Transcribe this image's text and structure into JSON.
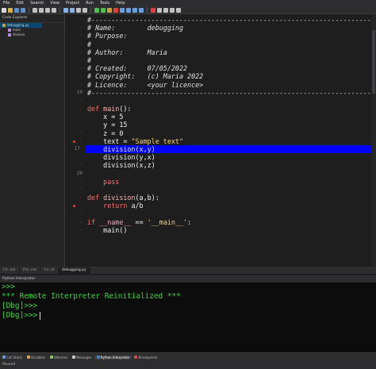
{
  "menu": [
    "File",
    "Edit",
    "Search",
    "View",
    "Project",
    "Run",
    "Tools",
    "Help"
  ],
  "explorer": {
    "title": "Code Explorer",
    "items": [
      {
        "label": "debugging.py"
      },
      {
        "label": "main"
      },
      {
        "label": "division"
      }
    ]
  },
  "editor": {
    "lines": [
      {
        "num": "",
        "bp": false,
        "current": false,
        "tokens": [
          {
            "c": "cm",
            "t": "#----------------------------------------------------------------------------------"
          }
        ]
      },
      {
        "num": "",
        "bp": false,
        "current": false,
        "tokens": [
          {
            "c": "cm",
            "t": "# Name:        debugging"
          }
        ]
      },
      {
        "num": "",
        "bp": false,
        "current": false,
        "tokens": [
          {
            "c": "cm",
            "t": "# Purpose:"
          }
        ]
      },
      {
        "num": "",
        "bp": false,
        "current": false,
        "tokens": [
          {
            "c": "cm",
            "t": "#"
          }
        ]
      },
      {
        "num": "",
        "bp": false,
        "current": false,
        "tokens": [
          {
            "c": "cm",
            "t": "# Author:      Maria"
          }
        ]
      },
      {
        "num": "",
        "bp": false,
        "current": false,
        "tokens": [
          {
            "c": "cm",
            "t": "#"
          }
        ]
      },
      {
        "num": "",
        "bp": false,
        "current": false,
        "tokens": [
          {
            "c": "cm",
            "t": "# Created:     07/05/2022"
          }
        ]
      },
      {
        "num": "",
        "bp": false,
        "current": false,
        "tokens": [
          {
            "c": "cm",
            "t": "# Copyright:   (c) Maria 2022"
          }
        ]
      },
      {
        "num": "",
        "bp": false,
        "current": false,
        "tokens": [
          {
            "c": "cm",
            "t": "# Licence:     <your licence>"
          }
        ]
      },
      {
        "num": "10",
        "bp": false,
        "current": false,
        "tokens": [
          {
            "c": "cm",
            "t": "#----------------------------------------------------------------------------------"
          }
        ]
      },
      {
        "num": "",
        "bp": false,
        "current": false,
        "tokens": []
      },
      {
        "num": "",
        "bp": false,
        "current": false,
        "tokens": [
          {
            "c": "kw",
            "t": "def "
          },
          {
            "c": "fn",
            "t": "main"
          },
          {
            "c": "plain",
            "t": "():"
          }
        ]
      },
      {
        "num": "",
        "bp": false,
        "current": false,
        "tokens": [
          {
            "c": "plain",
            "t": "    x = "
          },
          {
            "c": "num",
            "t": "5"
          }
        ]
      },
      {
        "num": "",
        "bp": false,
        "current": false,
        "tokens": [
          {
            "c": "plain",
            "t": "    y = "
          },
          {
            "c": "num",
            "t": "15"
          }
        ]
      },
      {
        "num": "",
        "bp": false,
        "current": false,
        "tokens": [
          {
            "c": "plain",
            "t": "    z = "
          },
          {
            "c": "num",
            "t": "0"
          }
        ]
      },
      {
        "num": "",
        "bp": true,
        "current": false,
        "tokens": [
          {
            "c": "plain",
            "t": "    text = "
          },
          {
            "c": "str",
            "t": "\"Sample text\""
          }
        ]
      },
      {
        "num": "17",
        "bp": false,
        "current": true,
        "tokens": [
          {
            "c": "plain",
            "t": "    division(x,y)"
          }
        ]
      },
      {
        "num": "",
        "bp": false,
        "current": false,
        "tokens": [
          {
            "c": "plain",
            "t": "    division(y,x)"
          }
        ]
      },
      {
        "num": "",
        "bp": false,
        "current": false,
        "tokens": [
          {
            "c": "plain",
            "t": "    division(x,z)"
          }
        ]
      },
      {
        "num": "20",
        "bp": false,
        "current": false,
        "tokens": []
      },
      {
        "num": "",
        "bp": false,
        "current": false,
        "tokens": [
          {
            "c": "kw",
            "t": "    pass"
          }
        ]
      },
      {
        "num": "",
        "bp": false,
        "current": false,
        "tokens": []
      },
      {
        "num": "",
        "bp": false,
        "current": false,
        "tokens": [
          {
            "c": "kw",
            "t": "def "
          },
          {
            "c": "fn",
            "t": "division"
          },
          {
            "c": "plain",
            "t": "(a,b):"
          }
        ]
      },
      {
        "num": "",
        "bp": true,
        "current": false,
        "tokens": [
          {
            "c": "kw",
            "t": "    return "
          },
          {
            "c": "plain",
            "t": "a/b"
          }
        ]
      },
      {
        "num": "",
        "bp": false,
        "current": false,
        "tokens": []
      },
      {
        "num": "",
        "bp": false,
        "current": false,
        "tokens": [
          {
            "c": "kw",
            "t": "if "
          },
          {
            "c": "dunder",
            "t": "__name__"
          },
          {
            "c": "plain",
            "t": " == "
          },
          {
            "c": "str",
            "t": "'__main__'"
          },
          {
            "c": "plain",
            "t": ":"
          }
        ]
      },
      {
        "num": "",
        "bp": false,
        "current": false,
        "tokens": [
          {
            "c": "plain",
            "t": "    main()"
          }
        ]
      }
    ]
  },
  "tabs": [
    {
      "label": "FX..ner",
      "active": false
    },
    {
      "label": "Pro..ner",
      "active": false
    },
    {
      "label": "Co..er",
      "active": false
    },
    {
      "label": "debugging.py",
      "active": true
    }
  ],
  "interpreter": {
    "title": "Python Interpreter",
    "lines": [
      {
        "cls": "green",
        "text": ">>>"
      },
      {
        "cls": "green",
        "text": "*** Remote Interpreter Reinitialized ***"
      },
      {
        "cls": "green",
        "text": "[Dbg]>>>"
      },
      {
        "cls": "green",
        "text": "[Dbg]>>>",
        "cursor": true
      }
    ]
  },
  "bottom_tabs": [
    {
      "label": "Call Stack",
      "icon": "call-stack-icon",
      "color": "#6a9bd8",
      "active": false
    },
    {
      "label": "Variables",
      "icon": "variables-icon",
      "color": "#d8a84a",
      "active": false
    },
    {
      "label": "Watches",
      "icon": "watches-icon",
      "color": "#8fbf6a",
      "active": false
    },
    {
      "label": "Messages",
      "icon": "messages-icon",
      "color": "#c8c8c8",
      "active": false
    },
    {
      "label": "Python Interpreter",
      "icon": "python-icon",
      "color": "#4a86c8",
      "active": true
    },
    {
      "label": "Breakpoints",
      "icon": "breakpoints-icon",
      "color": "#d04848",
      "active": false
    }
  ],
  "status": "Paused"
}
